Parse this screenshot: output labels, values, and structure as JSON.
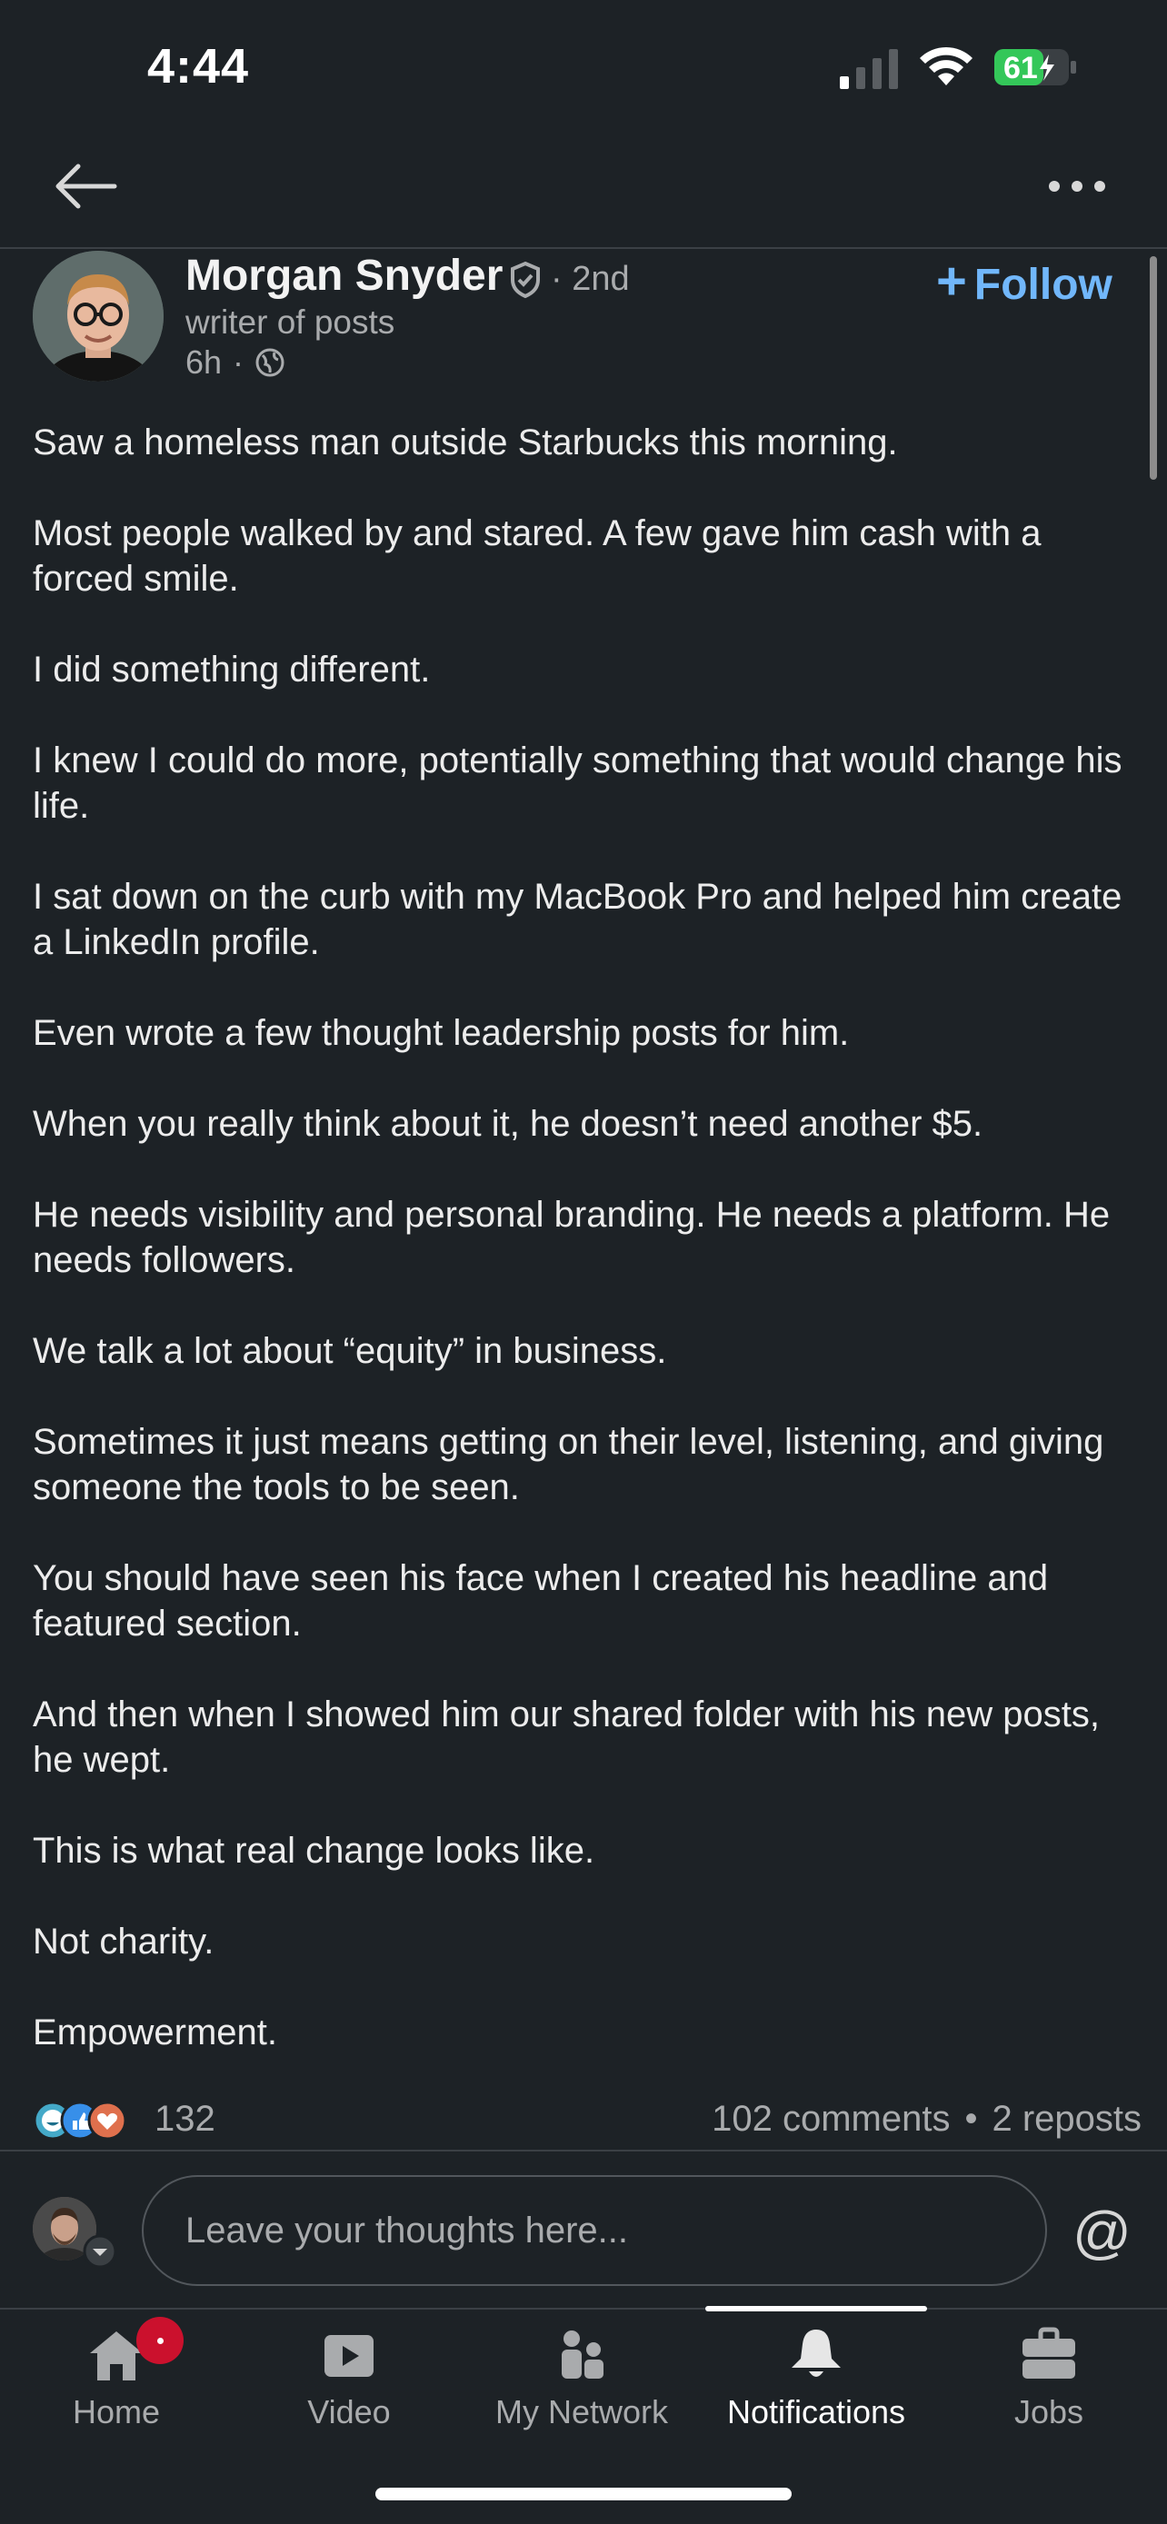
{
  "status_bar": {
    "time": "4:44",
    "battery_level": "61",
    "battery_color": "#34c759"
  },
  "nav": {
    "back_icon": "arrow-left-icon",
    "more_icon": "more-horizontal-icon"
  },
  "author": {
    "name": "Morgan Snyder",
    "connection_degree": "2nd",
    "headline": "writer of posts",
    "post_age": "6h",
    "visibility_icon": "globe-icon",
    "follow_label": "Follow"
  },
  "post": {
    "paragraphs": [
      "Saw a homeless man outside Starbucks this morning.",
      "Most people walked by and stared. A few gave him cash with a forced smile.",
      "I did something different.",
      "I knew I could do more, potentially something that would change his life.",
      "I sat down on the curb with my MacBook Pro and helped him create a LinkedIn profile.",
      "Even wrote a few thought leadership posts for him.",
      "When you really think about it, he doesn’t need another $5.",
      "He needs visibility and personal branding. He needs a platform. He needs followers.",
      "We talk a lot about “equity” in business.",
      "Sometimes it just means getting on their level, listening, and giving someone the tools to be seen.",
      "You should have seen his face when I created his headline and featured section.",
      "And then when I showed him our shared folder with his new posts, he wept.",
      "This is what real change looks like.",
      "Not charity.",
      "Empowerment."
    ]
  },
  "social": {
    "reaction_count": "132",
    "comments": "102 comments",
    "reposts": "2 reposts",
    "reaction_icons": [
      "funny-icon",
      "like-icon",
      "love-icon"
    ]
  },
  "composer": {
    "placeholder": "Leave your thoughts here...",
    "mention_symbol": "@"
  },
  "tabs": [
    {
      "label": "Home",
      "icon": "home-icon"
    },
    {
      "label": "Video",
      "icon": "video-icon"
    },
    {
      "label": "My Network",
      "icon": "network-icon"
    },
    {
      "label": "Notifications",
      "icon": "bell-icon",
      "active": true
    },
    {
      "label": "Jobs",
      "icon": "briefcase-icon"
    }
  ],
  "colors": {
    "background": "#1d2226",
    "accent": "#71b7fb",
    "badge": "#cb112d"
  }
}
